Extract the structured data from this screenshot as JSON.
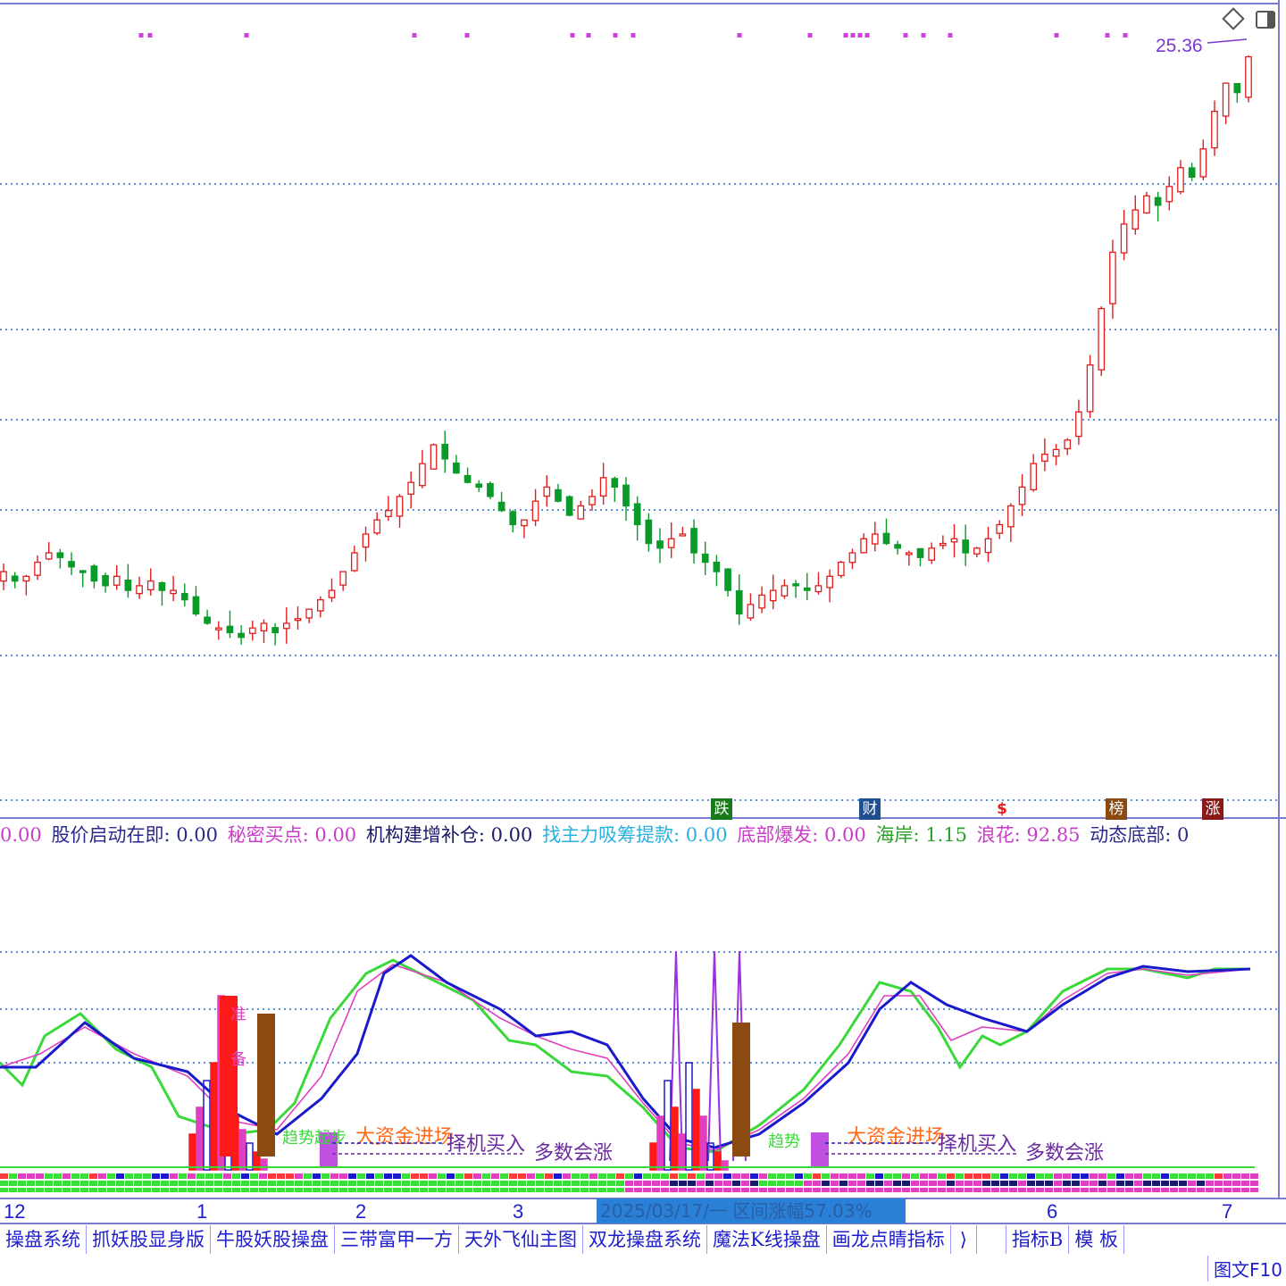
{
  "chart_data": {
    "type": "candlestick",
    "price_label": "25.36",
    "month_labels": [
      "12",
      "1",
      "2",
      "3",
      "6",
      "7"
    ],
    "date_bar": "2025/03/17/一 ",
    "date_bar_extra": "区间涨幅57.03%",
    "event_icons": [
      {
        "label": "跌",
        "color": "#1a7a1a"
      },
      {
        "label": "财",
        "color": "#1f4f8f"
      },
      {
        "label": "$",
        "color": "#e02020"
      },
      {
        "label": "榜",
        "color": "#8a4a10"
      },
      {
        "label": "涨",
        "color": "#8a1a1a"
      }
    ],
    "indicators": [
      {
        "text": "0.00",
        "color": "#c83cc8"
      },
      {
        "text": "股价启动在即: 0.00",
        "color": "#2a2a8a"
      },
      {
        "text": "秘密买点: 0.00",
        "color": "#c83cc8"
      },
      {
        "text": "机构建增补仓: 0.00",
        "color": "#1a1a6a"
      },
      {
        "text": "找主力吸筹提款: 0.00",
        "color": "#2ab0e0"
      },
      {
        "text": "底部爆发: 0.00",
        "color": "#c83cc8"
      },
      {
        "text": "海岸: 1.15",
        "color": "#2aa02a"
      },
      {
        "text": "浪花: 92.85",
        "color": "#c83cc8"
      },
      {
        "text": "动态底部: 0",
        "color": "#2a2a8a"
      }
    ],
    "annotations": [
      "大资金进场",
      "择机买入",
      "多数会涨",
      "趋势起步",
      "准",
      "备",
      "趋势"
    ],
    "close": [
      14.4,
      14.2,
      14.3,
      14.6,
      14.8,
      14.7,
      14.5,
      14.4,
      14.2,
      14.1,
      14.3,
      14.0,
      14.1,
      14.2,
      14.0,
      14.0,
      13.8,
      13.5,
      13.3,
      13.2,
      13.1,
      13.0,
      13.2,
      13.3,
      13.1,
      13.3,
      13.4,
      13.6,
      13.8,
      14.0,
      14.4,
      14.8,
      15.2,
      15.5,
      15.7,
      16.0,
      16.3,
      16.7,
      17.1,
      16.8,
      16.5,
      16.3,
      16.2,
      16.0,
      15.7,
      15.4,
      15.5,
      15.9,
      16.2,
      15.9,
      15.6,
      15.8,
      16.0,
      16.4,
      16.2,
      15.8,
      15.4,
      15.0,
      14.9,
      15.1,
      15.2,
      14.8,
      14.6,
      14.4,
      14.0,
      13.5,
      13.7,
      13.9,
      14.0,
      14.1,
      14.1,
      14.0,
      14.1,
      14.3,
      14.6,
      14.8,
      15.1,
      15.2,
      15.0,
      14.9,
      14.8,
      14.7,
      14.9,
      15.0,
      15.1,
      14.8,
      14.9,
      15.1,
      15.4,
      15.8,
      16.2,
      16.7,
      16.9,
      17.0,
      17.2,
      17.8,
      18.8,
      20.0,
      21.2,
      21.8,
      22.1,
      22.4,
      22.2,
      22.6,
      23.0,
      22.8,
      23.4,
      24.2,
      24.8,
      24.6,
      25.36
    ],
    "ylim": [
      12.5,
      26.0
    ]
  },
  "bottom_tabs": [
    "操盘系统",
    "抓妖股显身版",
    "牛股妖股操盘",
    "三带富甲一方",
    "天外飞仙主图",
    "双龙操盘系统",
    "魔法K线操盘",
    "画龙点睛指标",
    "⟩",
    "",
    "指标B",
    "模 板"
  ],
  "bottom_f10": "图文F10",
  "colors": {
    "up": "#e21d1d",
    "down": "#0a9a2a",
    "grid": "#2a6fcc",
    "accent": "#c040e0"
  }
}
